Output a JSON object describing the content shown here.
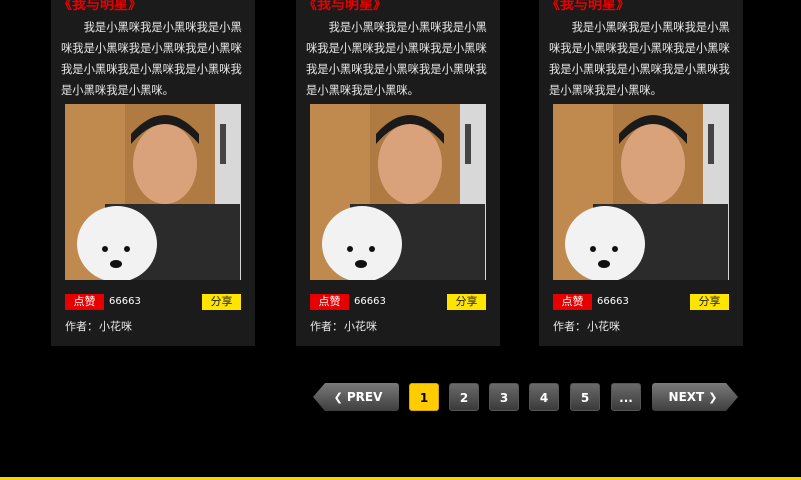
{
  "cards": [
    {
      "title": "《我与明星》",
      "text": "我是小黑咪我是小黑咪我是小黑咪我是小黑咪我是小黑咪我是小黑咪我是小黑咪我是小黑咪我是小黑咪我是小黑咪我是小黑咪。",
      "like_label": "点赞",
      "like_count": "66663",
      "share_label": "分享",
      "author_label": "作者：",
      "author_name": "小花咪"
    },
    {
      "title": "《我与明星》",
      "text": "我是小黑咪我是小黑咪我是小黑咪我是小黑咪我是小黑咪我是小黑咪我是小黑咪我是小黑咪我是小黑咪我是小黑咪我是小黑咪。",
      "like_label": "点赞",
      "like_count": "66663",
      "share_label": "分享",
      "author_label": "作者：",
      "author_name": "小花咪"
    },
    {
      "title": "《我与明星》",
      "text": "我是小黑咪我是小黑咪我是小黑咪我是小黑咪我是小黑咪我是小黑咪我是小黑咪我是小黑咪我是小黑咪我是小黑咪我是小黑咪。",
      "like_label": "点赞",
      "like_count": "66663",
      "share_label": "分享",
      "author_label": "作者：",
      "author_name": "小花咪"
    }
  ],
  "pagination": {
    "prev_label": "PREV",
    "next_label": "NEXT",
    "pages": [
      "1",
      "2",
      "3",
      "4",
      "5"
    ],
    "ellipsis": "...",
    "current": "1"
  },
  "colors": {
    "background": "#000000",
    "card": "#1b1b1b",
    "title_red": "#e60000",
    "like_red": "#e60000",
    "share_yellow": "#ffe400",
    "active_page": "#ffcc00"
  }
}
